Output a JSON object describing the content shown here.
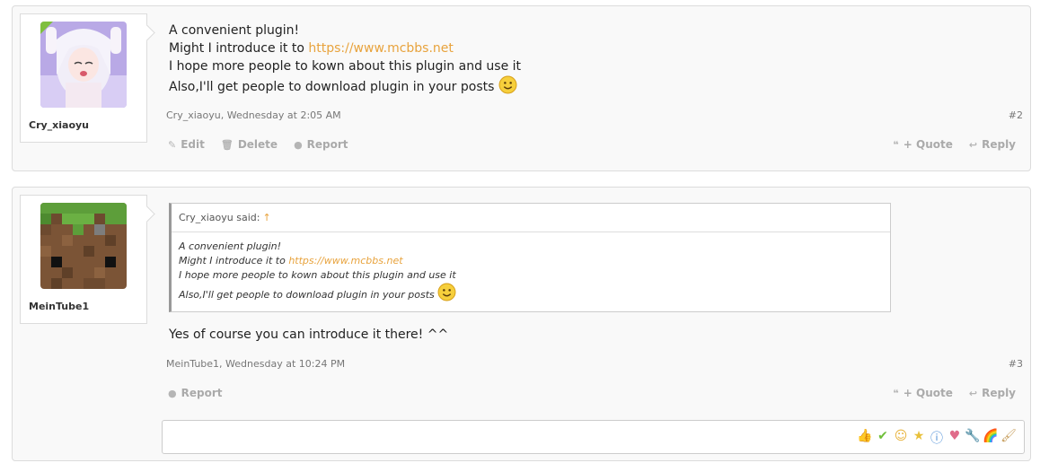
{
  "posts": [
    {
      "author": "Cry_xiaoyu",
      "avatar_icon": "anime-avatar",
      "message_lines": [
        "A convenient plugin!",
        "Might I introduce it to ",
        "I hope more people to kown about this plugin and use it",
        "Also,I'll get people to download plugin in your posts"
      ],
      "link_text": "https://www.mcbbs.net",
      "meta": "Cry_xiaoyu, Wednesday at 2:05 AM",
      "number": "#2",
      "actions_left": [
        "Edit",
        "Delete",
        "Report"
      ],
      "actions_right": [
        "+ Quote",
        "Reply"
      ]
    },
    {
      "author": "MeinTube1",
      "avatar_icon": "minecraft-grass-block-avatar",
      "quote": {
        "header": "Cry_xiaoyu said:",
        "arrow": "↑",
        "lines": [
          "A convenient plugin!",
          "Might I introduce it to ",
          "I hope more people to kown about this plugin and use it",
          "Also,I'll get people to download plugin in your posts"
        ],
        "link_text": "https://www.mcbbs.net"
      },
      "message": "Yes of course you can introduce it there! ^^",
      "meta": "MeinTube1, Wednesday at 10:24 PM",
      "number": "#3",
      "actions_left": [
        "Report"
      ],
      "actions_right": [
        "+ Quote",
        "Reply"
      ]
    }
  ],
  "reaction_icons": [
    "thumbs-up",
    "check",
    "smile",
    "star",
    "info",
    "heart",
    "wrench",
    "rainbow",
    "brush"
  ],
  "colors": {
    "link": "#e8a33d",
    "online": "#7fbf3f"
  }
}
